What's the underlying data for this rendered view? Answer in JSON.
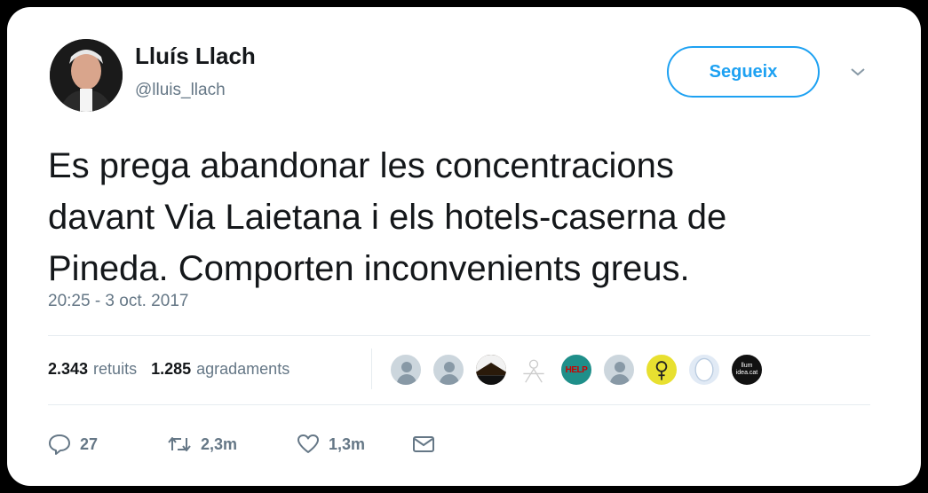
{
  "author": {
    "name": "Lluís Llach",
    "handle": "@lluis_llach"
  },
  "follow_button": {
    "label": "Segueix"
  },
  "tweet": {
    "lines": [
      "Es prega abandonar les concentracions",
      "davant Via Laietana i els hotels-caserna de",
      "Pineda. Comporten inconvenients greus."
    ],
    "timestamp": "20:25 - 3 oct. 2017"
  },
  "stats": {
    "retweets_count": "2.343",
    "retweets_label": "retuits",
    "likes_count": "1.285",
    "likes_label": "agradaments"
  },
  "liker_avatars": {
    "help_text": "HELP",
    "tiny_text": "llum\nidea.cat"
  },
  "actions": {
    "replies": "27",
    "retweets": "2,3m",
    "likes": "1,3m"
  },
  "colors": {
    "accent": "#1da1f2",
    "text": "#14171a",
    "muted": "#657786"
  }
}
